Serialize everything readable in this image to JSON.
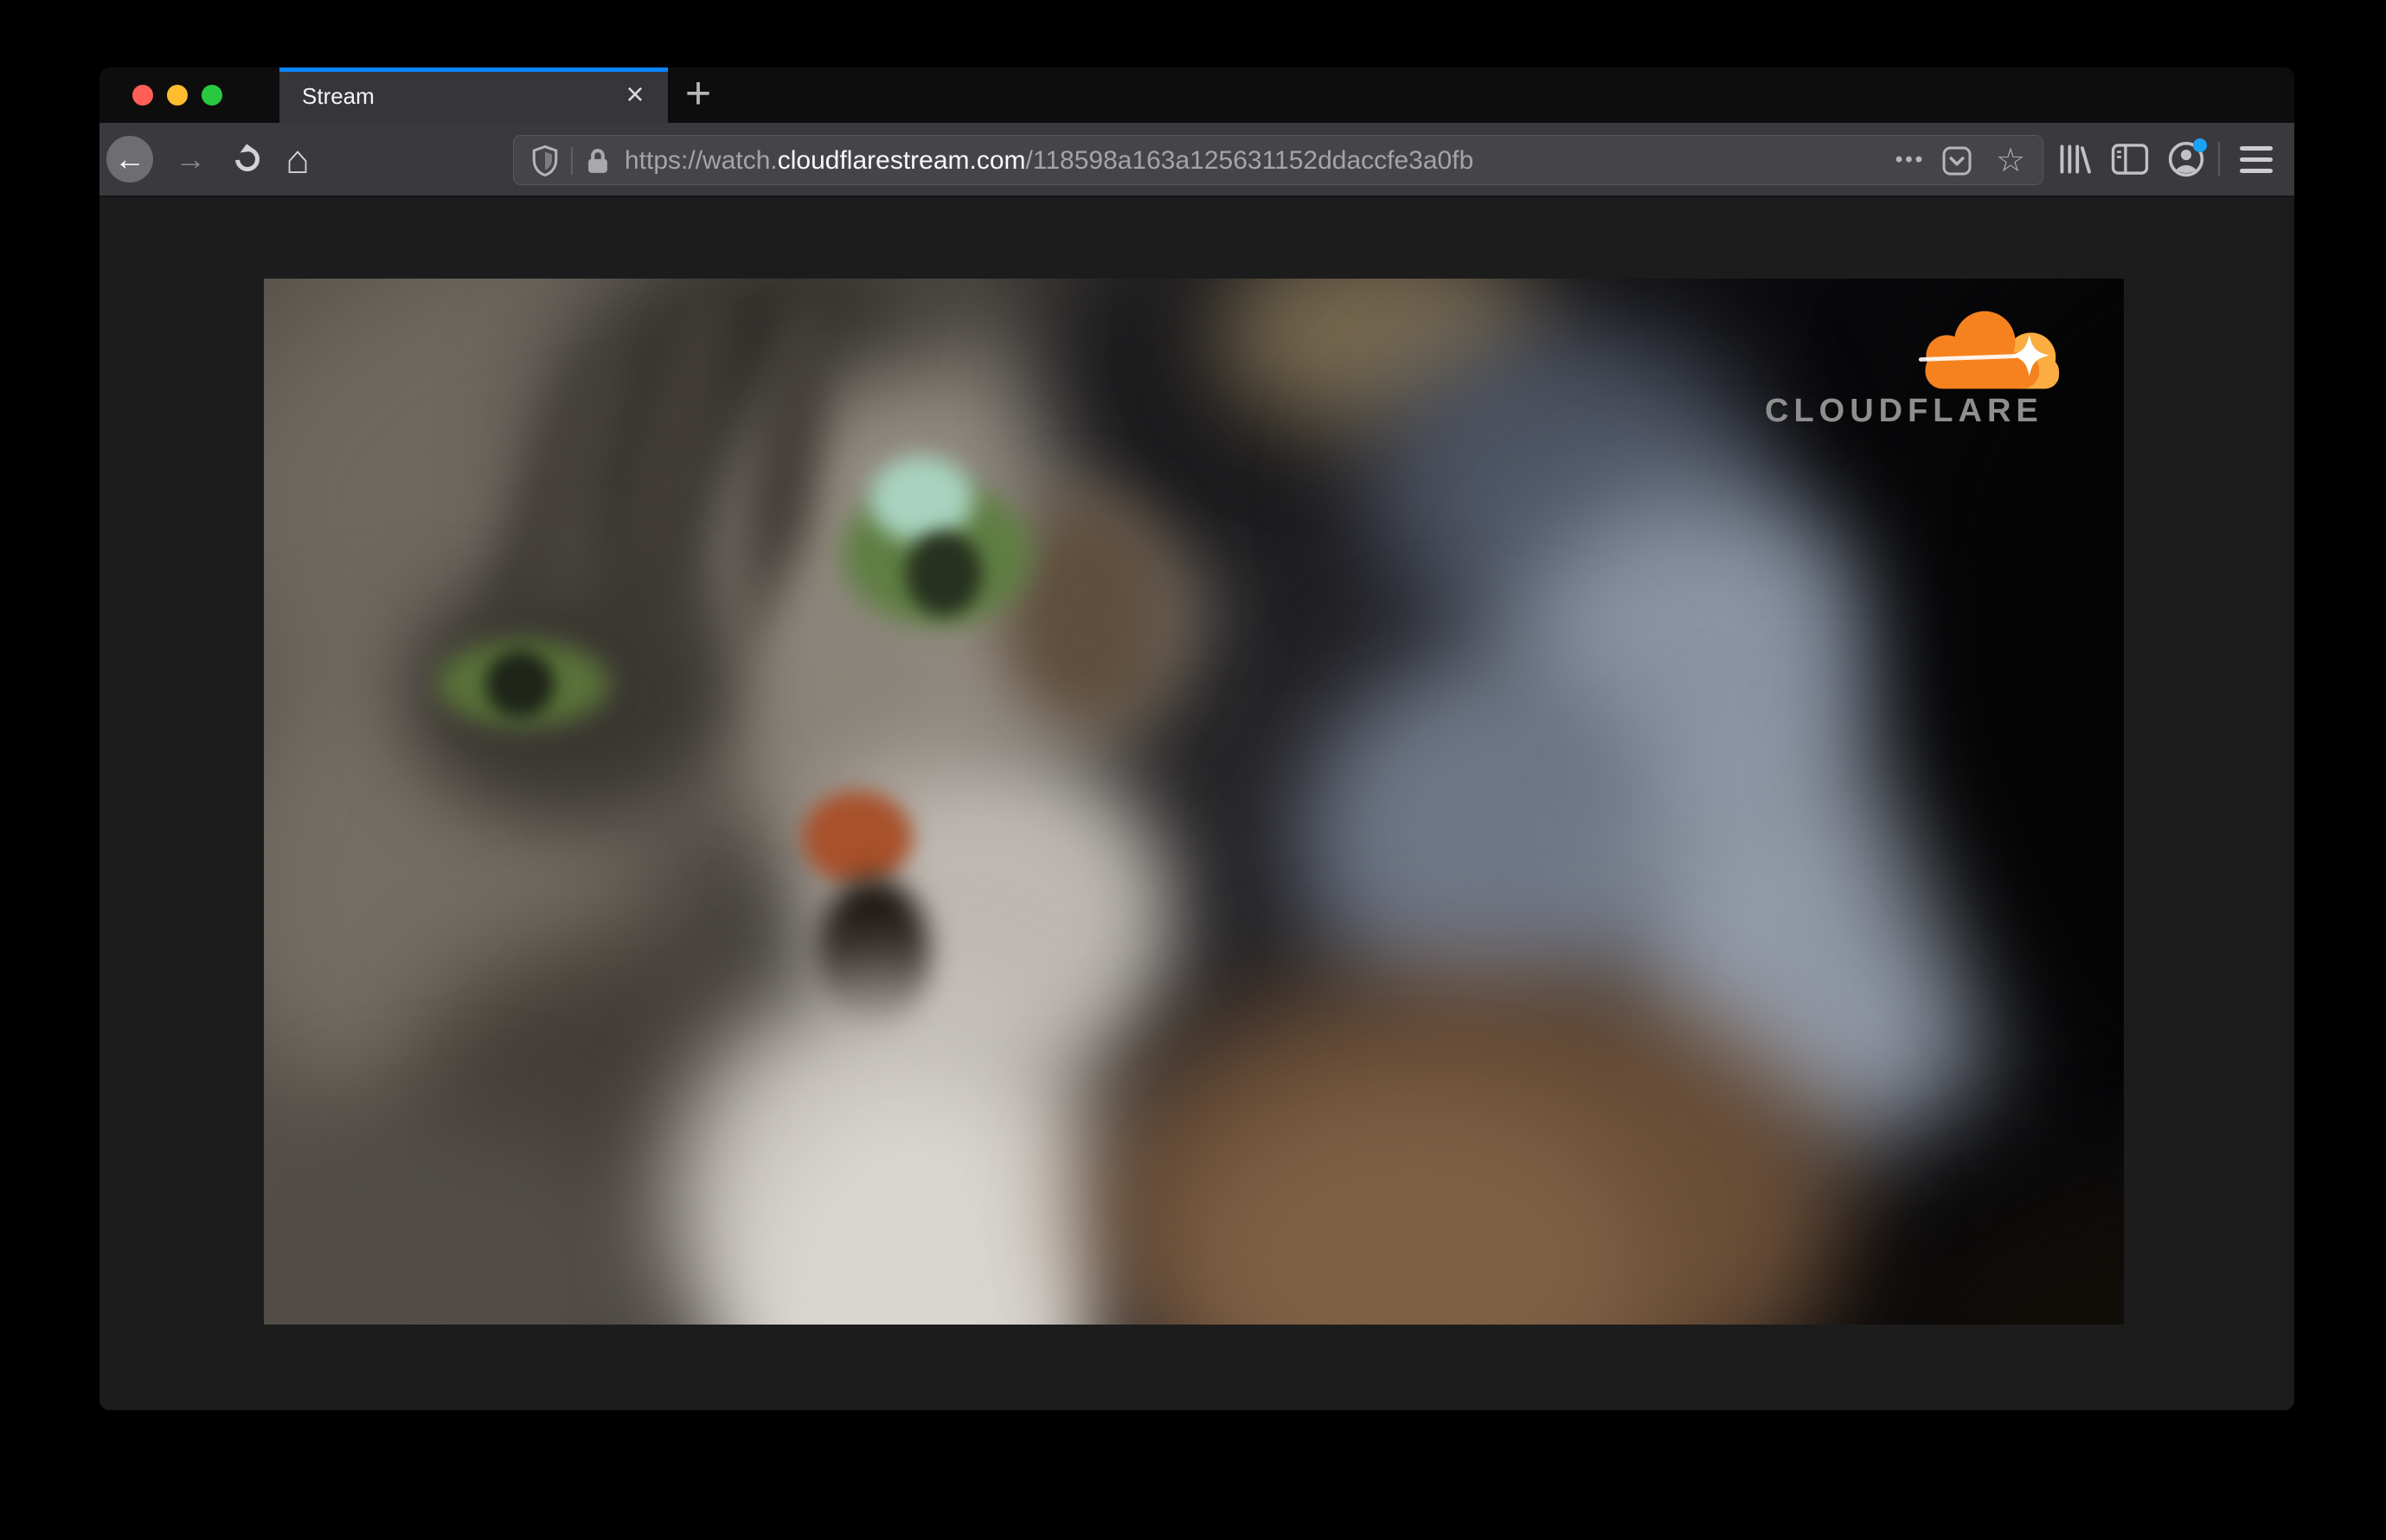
{
  "colors": {
    "accent_blue": "#0a84ff",
    "traffic_red": "#ff5f57",
    "traffic_yellow": "#febc2e",
    "traffic_green": "#28c840",
    "notification_blue": "#1ba2f4",
    "cloudflare_orange": "#f6821f",
    "cloudflare_orange_light": "#fbad41",
    "toolbar_icon_gray": "#c2c2c4"
  },
  "tab_bar": {
    "active_tab": {
      "title": "Stream",
      "close_icon": "×"
    },
    "new_tab_icon": "+"
  },
  "toolbar": {
    "back_icon": "←",
    "forward_icon": "→",
    "home_icon": "⌂",
    "url_bar": {
      "page_actions_icon": "•••",
      "bookmark_icon": "☆",
      "url_scheme": "https://watch.",
      "url_domain": "cloudflarestream.com",
      "url_path": "/118598a163a125631152ddaccfe3a0fb"
    }
  },
  "page": {
    "video_player": {
      "watermark_text": "CLOUDFLARE"
    }
  }
}
